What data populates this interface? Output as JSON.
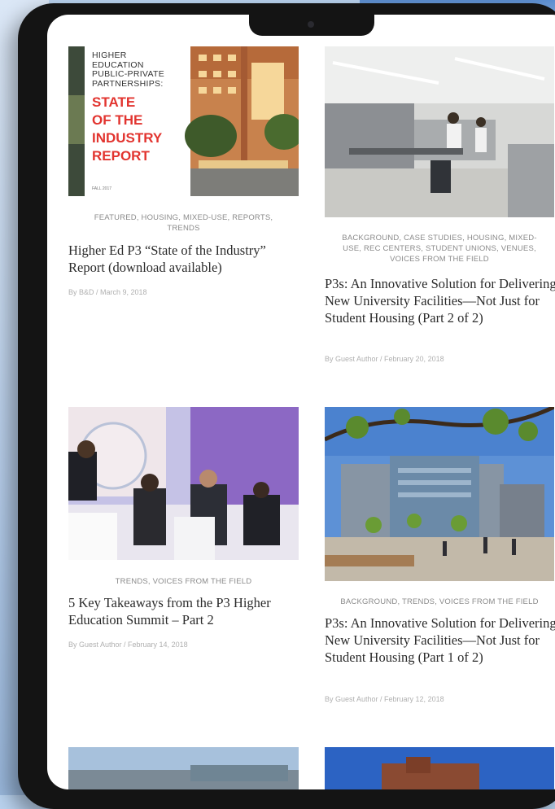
{
  "posts": [
    {
      "categories": "FEATURED, HOUSING, MIXED-USE, REPORTS, TRENDS",
      "title": "Higher Ed P3 “State of the Industry” Report (download available)",
      "meta": "By B&D / March 9, 2018",
      "cover": {
        "lines": [
          "HIGHER",
          "EDUCATION",
          "PUBLIC-PRIVATE",
          "PARTNERSHIPS:"
        ],
        "headline": [
          "STATE",
          "OF THE",
          "INDUSTRY",
          "REPORT"
        ],
        "date": "FALL 2017"
      }
    },
    {
      "categories": "BACKGROUND, CASE STUDIES, HOUSING, MIXED-USE, REC CENTERS, STUDENT UNIONS, VENUES, VOICES FROM THE FIELD",
      "title": "P3s: An Innovative Solution for Delivering New University Facilities—Not Just for Student Housing (Part 2 of 2)",
      "meta": "By Guest Author / February 20, 2018"
    },
    {
      "categories": "TRENDS, VOICES FROM THE FIELD",
      "title": "5 Key Takeaways from the P3 Higher Education Summit – Part 2",
      "meta": "By Guest Author / February 14, 2018"
    },
    {
      "categories": "BACKGROUND, TRENDS, VOICES FROM THE FIELD",
      "title": "P3s: An Innovative Solution for Delivering New University Facilities—Not Just for Student Housing (Part 1 of 2)",
      "meta": "By Guest Author / February 12, 2018"
    }
  ],
  "colors": {
    "accent": "#e2342f",
    "text": "#2b2b2b",
    "muted": "#8a8a8a"
  }
}
